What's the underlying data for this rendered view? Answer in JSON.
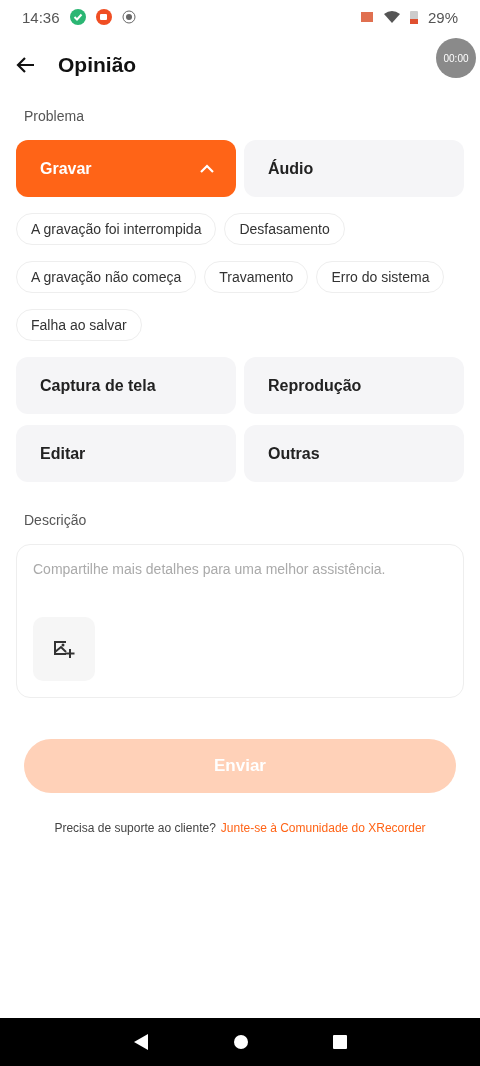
{
  "status_bar": {
    "time": "14:36",
    "battery": "29%"
  },
  "header": {
    "title": "Opinião",
    "timer": "00:00"
  },
  "problem": {
    "label": "Problema",
    "categories": [
      {
        "label": "Gravar",
        "selected": true,
        "expanded": true,
        "chips": [
          {
            "label": "A gravação foi interrompida",
            "selected": false
          },
          {
            "label": "Desfasamento",
            "selected": false
          },
          {
            "label": "A gravação não começa",
            "selected": false
          },
          {
            "label": "Travamento",
            "selected": false
          },
          {
            "label": "Erro do sistema",
            "selected": false
          },
          {
            "label": "Falha ao salvar",
            "selected": false
          }
        ]
      },
      {
        "label": "Áudio",
        "selected": false
      },
      {
        "label": "Captura de tela",
        "selected": false
      },
      {
        "label": "Reprodução",
        "selected": false
      },
      {
        "label": "Editar",
        "selected": false
      },
      {
        "label": "Outras",
        "selected": false
      }
    ]
  },
  "description": {
    "label": "Descrição",
    "placeholder": "Compartilhe mais detalhes para uma melhor assistência."
  },
  "submit": {
    "label": "Enviar",
    "disabled": true
  },
  "support": {
    "text": "Precisa de suporte ao cliente?",
    "link": "Junte-se à Comunidade do XRecorder"
  }
}
